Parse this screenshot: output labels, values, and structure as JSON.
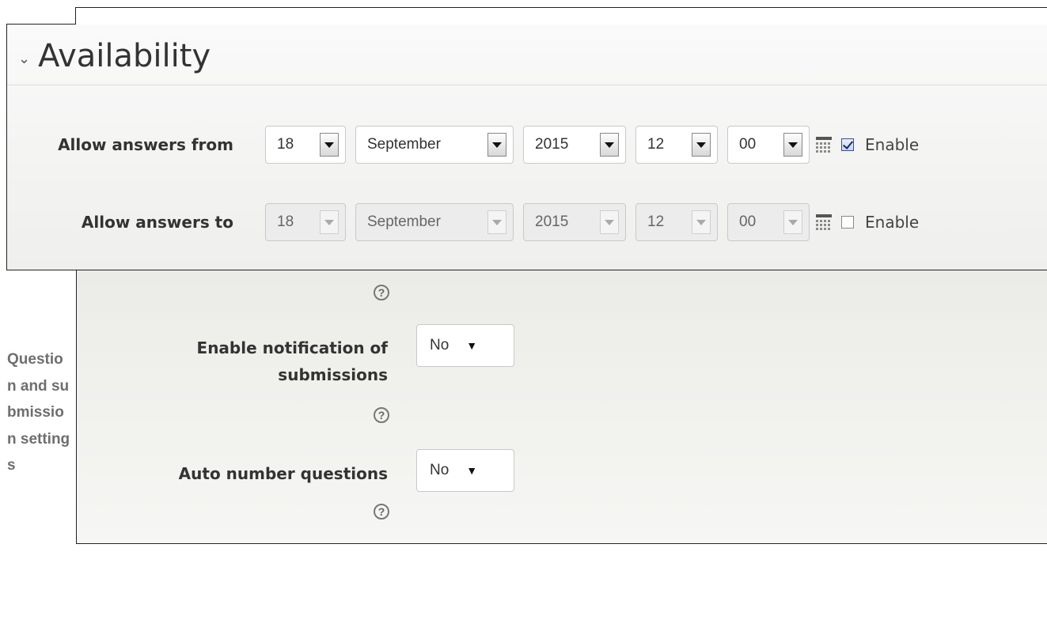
{
  "section": {
    "title": "Availability",
    "side_caption": "Question and submission settings"
  },
  "allow_from": {
    "label": "Allow answers from",
    "day": "18",
    "month": "September",
    "year": "2015",
    "hour": "12",
    "minute": "00",
    "enable_label": "Enable",
    "enabled": true
  },
  "allow_to": {
    "label": "Allow answers to",
    "day": "18",
    "month": "September",
    "year": "2015",
    "hour": "12",
    "minute": "00",
    "enable_label": "Enable",
    "enabled": false
  },
  "notification": {
    "label_line1": "Enable notification of",
    "label_line2": "submissions",
    "value": "No"
  },
  "auto_number": {
    "label": "Auto number questions",
    "value": "No"
  },
  "help_glyph": "?"
}
